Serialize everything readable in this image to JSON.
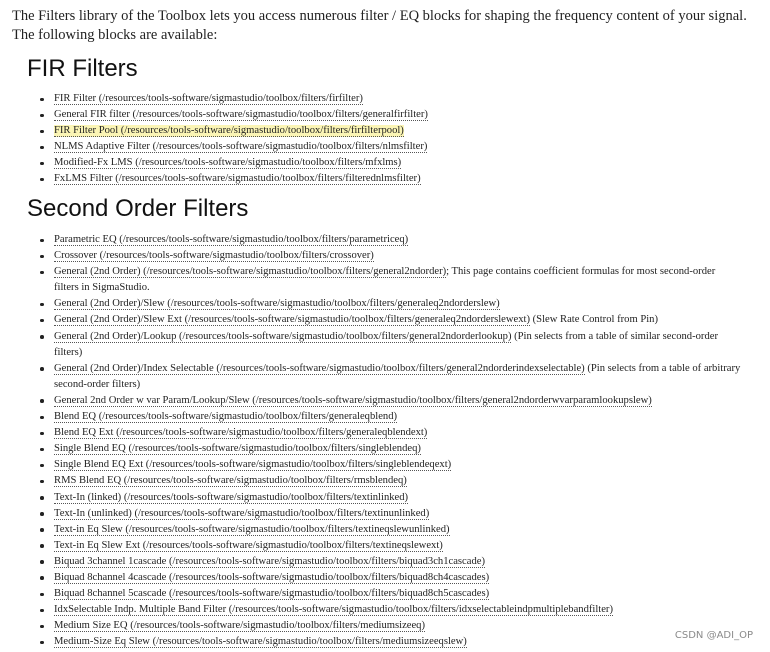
{
  "intro": "The Filters library of the Toolbox lets you access numerous filter / EQ blocks for shaping the frequency content of your signal. The following blocks are available:",
  "sections": [
    {
      "heading": "FIR Filters",
      "items": [
        {
          "link": "FIR Filter (/resources/tools-software/sigmastudio/toolbox/filters/firfilter)",
          "note": ""
        },
        {
          "link": "General FIR filter (/resources/tools-software/sigmastudio/toolbox/filters/generalfirfilter)",
          "note": ""
        },
        {
          "link": "FIR Filter Pool (/resources/tools-software/sigmastudio/toolbox/filters/firfilterpool)",
          "note": "",
          "highlight": true
        },
        {
          "link": "NLMS Adaptive Filter (/resources/tools-software/sigmastudio/toolbox/filters/nlmsfilter)",
          "note": ""
        },
        {
          "link": "Modified-Fx LMS (/resources/tools-software/sigmastudio/toolbox/filters/mfxlms)",
          "note": ""
        },
        {
          "link": "FxLMS Filter (/resources/tools-software/sigmastudio/toolbox/filters/filterednlmsfilter)",
          "note": ""
        }
      ]
    },
    {
      "heading": "Second Order Filters",
      "items": [
        {
          "link": "Parametric EQ (/resources/tools-software/sigmastudio/toolbox/filters/parametriceq)",
          "note": ""
        },
        {
          "link": "Crossover (/resources/tools-software/sigmastudio/toolbox/filters/crossover)",
          "note": ""
        },
        {
          "link": "General (2nd Order) (/resources/tools-software/sigmastudio/toolbox/filters/general2ndorder)",
          "note": "; This page contains coefficient formulas for most second-order filters in SigmaStudio.",
          "wrap": true
        },
        {
          "link": "General (2nd Order)/Slew (/resources/tools-software/sigmastudio/toolbox/filters/generaleq2ndorderslew)",
          "note": ""
        },
        {
          "link": "General (2nd Order)/Slew Ext (/resources/tools-software/sigmastudio/toolbox/filters/generaleq2ndorderslewext)",
          "note": " (Slew Rate Control from Pin)"
        },
        {
          "link": "General (2nd Order)/Lookup (/resources/tools-software/sigmastudio/toolbox/filters/general2ndorderlookup)",
          "note": " (Pin selects from a table of similar second-order filters)",
          "wrap": true
        },
        {
          "link": "General (2nd Order)/Index Selectable (/resources/tools-software/sigmastudio/toolbox/filters/general2ndorderindexselectable)",
          "note": " (Pin selects from a table of arbitrary second-order filters)",
          "wrap": true
        },
        {
          "link": "General 2nd Order w var Param/Lookup/Slew (/resources/tools-software/sigmastudio/toolbox/filters/general2ndorderwvarparamlookupslew)",
          "note": ""
        },
        {
          "link": "Blend EQ (/resources/tools-software/sigmastudio/toolbox/filters/generaleqblend)",
          "note": ""
        },
        {
          "link": "Blend EQ Ext (/resources/tools-software/sigmastudio/toolbox/filters/generaleqblendext)",
          "note": ""
        },
        {
          "link": "Single Blend EQ (/resources/tools-software/sigmastudio/toolbox/filters/singleblendeq)",
          "note": ""
        },
        {
          "link": "Single Blend EQ Ext (/resources/tools-software/sigmastudio/toolbox/filters/singleblendeqext)",
          "note": ""
        },
        {
          "link": "RMS Blend EQ (/resources/tools-software/sigmastudio/toolbox/filters/rmsblendeq)",
          "note": ""
        },
        {
          "link": "Text-In (linked) (/resources/tools-software/sigmastudio/toolbox/filters/textinlinked)",
          "note": ""
        },
        {
          "link": "Text-In (unlinked) (/resources/tools-software/sigmastudio/toolbox/filters/textinunlinked)",
          "note": ""
        },
        {
          "link": "Text-in Eq Slew (/resources/tools-software/sigmastudio/toolbox/filters/textineqslewunlinked)",
          "note": ""
        },
        {
          "link": "Text-in Eq Slew Ext (/resources/tools-software/sigmastudio/toolbox/filters/textineqslewext)",
          "note": ""
        },
        {
          "link": "Biquad 3channel 1cascade (/resources/tools-software/sigmastudio/toolbox/filters/biquad3ch1cascade)",
          "note": ""
        },
        {
          "link": "Biquad 8channel 4cascade (/resources/tools-software/sigmastudio/toolbox/filters/biquad8ch4cascades)",
          "note": ""
        },
        {
          "link": "Biquad 8channel 5cascade (/resources/tools-software/sigmastudio/toolbox/filters/biquad8ch5cascades)",
          "note": ""
        },
        {
          "link": "IdxSelectable Indp. Multiple Band Filter (/resources/tools-software/sigmastudio/toolbox/filters/idxselectableindpmultiplebandfilter)",
          "note": ""
        },
        {
          "link": "Medium Size EQ (/resources/tools-software/sigmastudio/toolbox/filters/mediumsizeeq)",
          "note": ""
        },
        {
          "link": "Medium-Size Eq Slew (/resources/tools-software/sigmastudio/toolbox/filters/mediumsizeeqslew)",
          "note": ""
        }
      ]
    }
  ],
  "watermark": "CSDN @ADI_OP"
}
